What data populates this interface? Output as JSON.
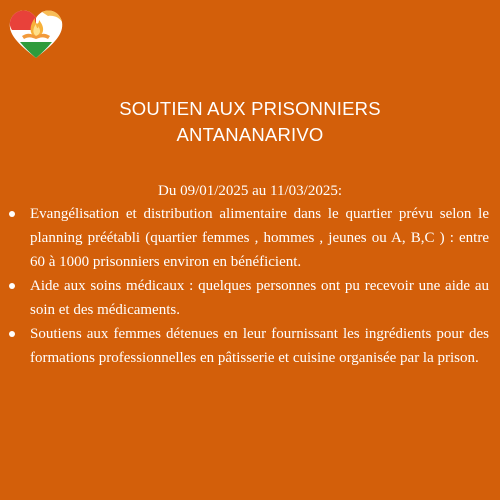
{
  "header": {
    "logo_icon": "heart-flame-logo-icon",
    "colors": {
      "background": "#d35f0a",
      "heart_red": "#e8413a",
      "heart_white": "#ffffff",
      "heart_green": "#2f9b3c",
      "flame": "#f7b13a"
    }
  },
  "title": {
    "line1": "SOUTIEN AUX PRISONNIERS",
    "line2": "ANTANANARIVO"
  },
  "period": "Du 09/01/2025 au 11/03/2025:",
  "items": [
    {
      "text": "Evangélisation et distribution alimentaire dans le quartier prévu selon le planning préétabli (quartier femmes , hommes , jeunes ou A, B,C ) : entre 60 à 1000 prisonniers environ en bénéficient."
    },
    {
      "text": "Aide aux soins médicaux : quelques personnes ont pu recevoir une aide au soin et des médicaments."
    },
    {
      "text": "Soutiens aux femmes détenues en leur fournissant les ingrédients pour des formations professionnelles en pâtisserie et cuisine organisée par la prison."
    }
  ]
}
